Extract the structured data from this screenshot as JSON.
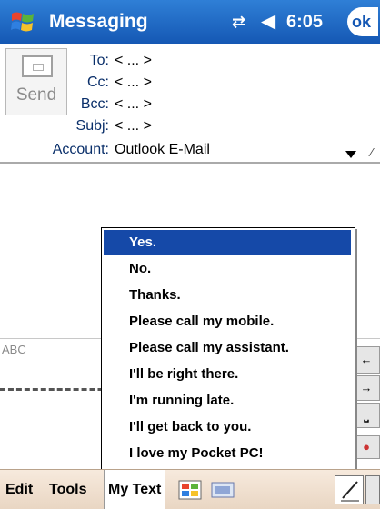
{
  "titlebar": {
    "title": "Messaging",
    "time": "6:05",
    "ok_label": "ok",
    "icons": [
      "windows-start-icon",
      "connectivity-icon",
      "volume-icon"
    ]
  },
  "header": {
    "send_label": "Send",
    "fields": [
      {
        "label": "To:",
        "value": "< ... >"
      },
      {
        "label": "Cc:",
        "value": "< ... >"
      },
      {
        "label": "Bcc:",
        "value": "< ... >"
      },
      {
        "label": "Subj:",
        "value": "< ... >"
      }
    ],
    "account_label": "Account:",
    "account_value": "Outlook E-Mail"
  },
  "input_panel": {
    "mode_label": "ABC"
  },
  "mytext_menu": {
    "items": [
      "Yes.",
      "No.",
      "Thanks.",
      "Please call my mobile.",
      "Please call my assistant.",
      "I'll be right there.",
      "I'm running late.",
      "I'll get back to you.",
      "I love my Pocket PC!"
    ],
    "selected_index": 0
  },
  "menubar": {
    "edit": "Edit",
    "tools": "Tools",
    "mytext": "My Text"
  },
  "colors": {
    "titlebar": "#1558b4",
    "selection": "#1549a8",
    "menubar": "#f0e0cf"
  }
}
